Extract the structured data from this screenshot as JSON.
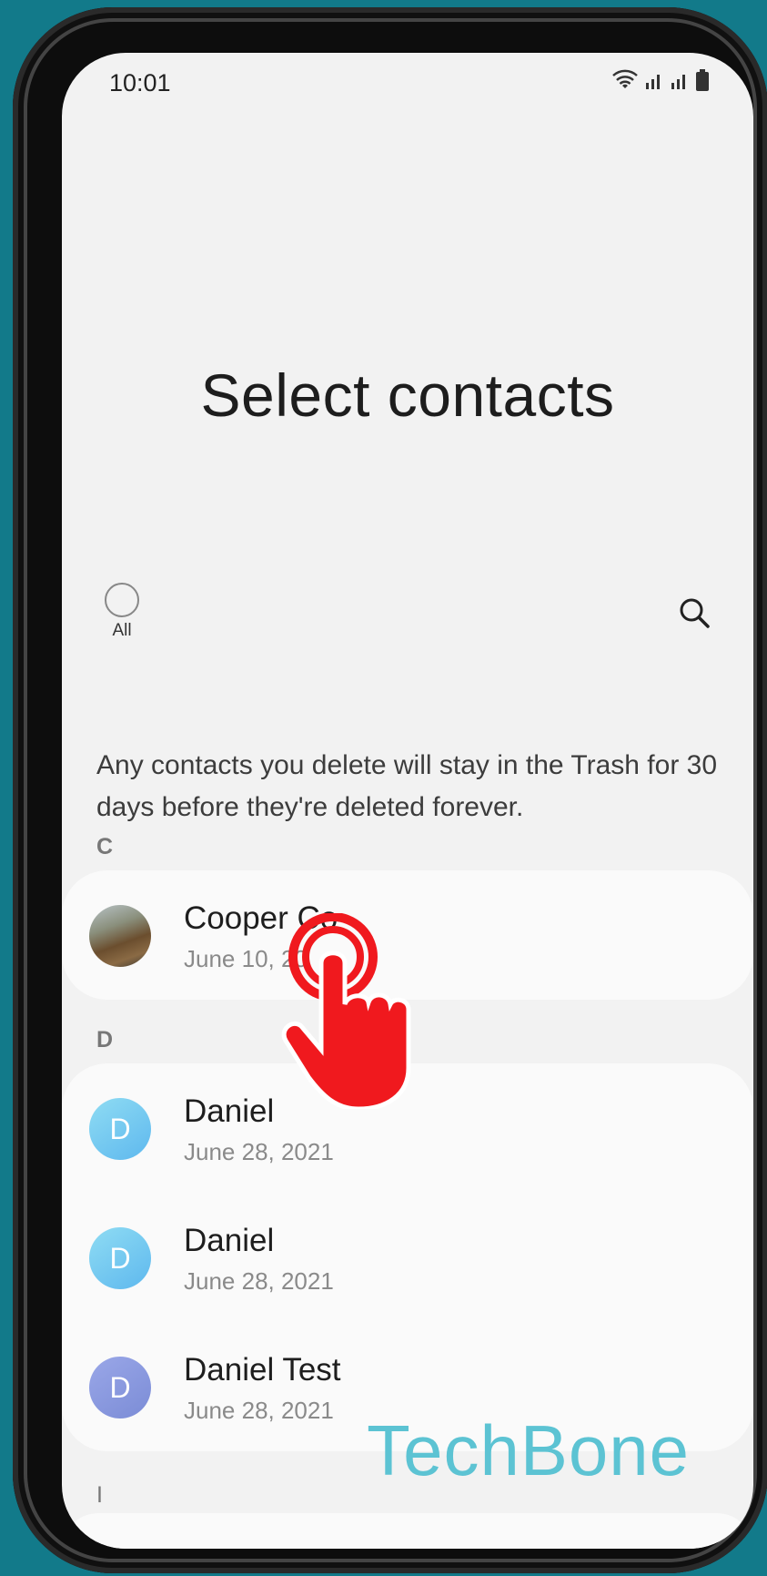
{
  "status": {
    "time": "10:01",
    "icons": [
      "wifi-icon",
      "signal-icon",
      "signal-icon",
      "battery-icon"
    ]
  },
  "page": {
    "title": "Select contacts",
    "select_all_label": "All",
    "notice": "Any contacts you delete will stay in the Trash for 30 days before they're deleted forever."
  },
  "sections": [
    {
      "letter": "C",
      "contacts": [
        {
          "name": "Cooper Co",
          "date": "June 10, 20",
          "avatar": "photo"
        }
      ]
    },
    {
      "letter": "D",
      "contacts": [
        {
          "name": "Daniel",
          "date": "June 28, 2021",
          "avatar": "D"
        },
        {
          "name": "Daniel",
          "date": "June 28, 2021",
          "avatar": "D"
        },
        {
          "name": "Daniel Test",
          "date": "June 28, 2021",
          "avatar": "D"
        }
      ]
    },
    {
      "letter": "I",
      "contacts": []
    }
  ],
  "watermark": "TechBone",
  "colors": {
    "background": "#127a8a",
    "screen": "#f2f2f2",
    "card": "#fafafa",
    "hand": "#f0191e",
    "watermark": "#5cc3d3"
  }
}
